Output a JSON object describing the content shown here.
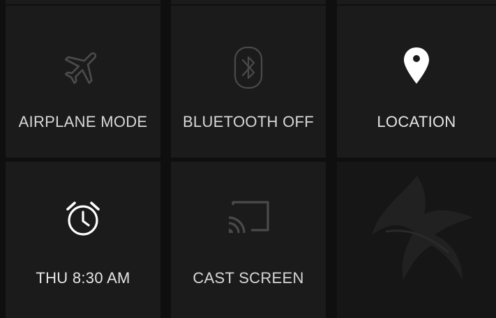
{
  "tiles": {
    "airplane": {
      "label": "AIRPLANE MODE",
      "icon": "airplane-icon",
      "state": "off"
    },
    "bluetooth": {
      "label": "BLUETOOTH OFF",
      "icon": "bluetooth-icon",
      "state": "off"
    },
    "location": {
      "label": "LOCATION",
      "icon": "location-pin-icon",
      "state": "on"
    },
    "alarm": {
      "label": "THU 8:30 AM",
      "icon": "alarm-clock-icon",
      "state": "on"
    },
    "cast": {
      "label": "CAST SCREEN",
      "icon": "cast-icon",
      "state": "off"
    }
  },
  "colors": {
    "tile_bg": "#1b1b1b",
    "panel_bg": "#0f0f0f",
    "icon_on": "#ffffff",
    "icon_off": "#4a4a4a",
    "label": "#d8d8d8"
  }
}
